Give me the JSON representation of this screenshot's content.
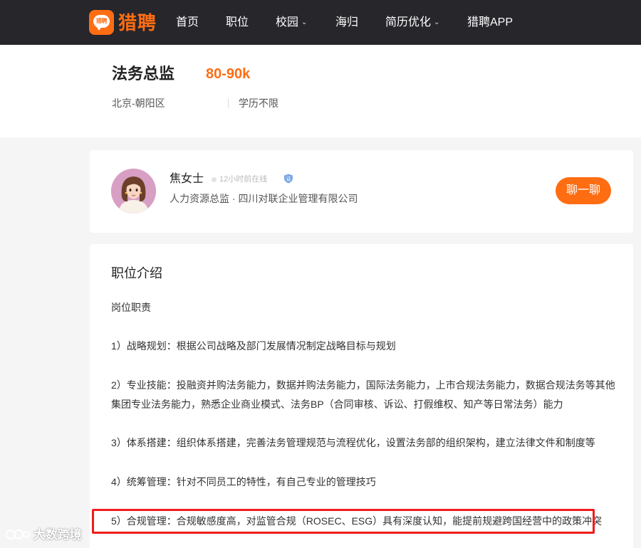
{
  "brand": {
    "logo_badge": "猎聘",
    "name": "猎聘",
    "color": "#ff6d13"
  },
  "nav": {
    "items": [
      {
        "label": "首页"
      },
      {
        "label": "职位"
      },
      {
        "label": "校园"
      },
      {
        "label": "海归"
      },
      {
        "label": "简历优化"
      },
      {
        "label": "猎聘APP"
      }
    ]
  },
  "job": {
    "title": "法务总监",
    "salary": "80-90k",
    "location": "北京-朝阳区",
    "education": "学历不限"
  },
  "recruiter": {
    "name": "焦女士",
    "online_status": "12小时前在线",
    "verified_badge": "证",
    "subtitle": "人力资源总监 · 四川对联企业管理有限公司",
    "chat_label": "聊一聊"
  },
  "description": {
    "section_title": "职位介绍",
    "lines": [
      "岗位职责",
      "1）战略规划：根据公司战略及部门发展情况制定战略目标与规划",
      "2）专业技能：投融资并购法务能力，数据并购法务能力，国际法务能力，上市合规法务能力，数据合规法务等其他",
      "集团专业法务能力，熟悉企业商业模式、法务BP（合同审核、诉讼、打假维权、知产等日常法务）能力",
      "3）体系搭建：组织体系搭建，完善法务管理规范与流程优化，设置法务部的组织架构，建立法律文件和制度等",
      "4）统筹管理：针对不同员工的特性，有自己专业的管理技巧",
      "5）合规管理：合规敏感度高，对监管合规（ROSEC、ESG）具有深度认知，能提前规避跨国经营中的政策冲突"
    ]
  },
  "watermark": {
    "text": "大数跨境"
  },
  "colors": {
    "nav_bg": "#26262b",
    "accent": "#ff6d13",
    "highlight": "#f01c1c"
  }
}
